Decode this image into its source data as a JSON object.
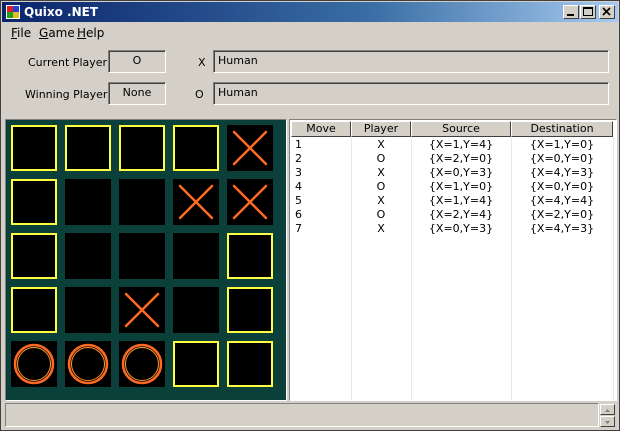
{
  "window": {
    "title": "Quixo .NET"
  },
  "menu": [
    {
      "label_u": "F",
      "label_rest": "ile"
    },
    {
      "label_u": "G",
      "label_rest": "ame"
    },
    {
      "label_u": "H",
      "label_rest": "elp"
    }
  ],
  "info": {
    "current_player_label": "Current Player",
    "current_player_value": "O",
    "winning_player_label": "Winning Player",
    "winning_player_value": "None",
    "x_label": "X",
    "x_player": "Human",
    "o_label": "O",
    "o_player": "Human"
  },
  "board": [
    [
      "empty-lit",
      "empty-lit",
      "empty-lit",
      "empty-lit",
      "x"
    ],
    [
      "empty-lit",
      "empty",
      "empty",
      "x",
      "x"
    ],
    [
      "empty-lit",
      "empty",
      "empty",
      "empty",
      "empty-lit"
    ],
    [
      "empty-lit",
      "empty",
      "x",
      "empty",
      "empty-lit"
    ],
    [
      "o",
      "o",
      "o",
      "empty-lit",
      "empty-lit"
    ]
  ],
  "colors": {
    "board_bg": "#0a3f3a",
    "cell_border": "#ffff40",
    "mark": "#ff6a20"
  },
  "moves": {
    "headers": [
      "Move",
      "Player",
      "Source",
      "Destination"
    ],
    "rows": [
      [
        "1",
        "X",
        "{X=1,Y=4}",
        "{X=1,Y=0}"
      ],
      [
        "2",
        "O",
        "{X=2,Y=0}",
        "{X=0,Y=0}"
      ],
      [
        "3",
        "X",
        "{X=0,Y=3}",
        "{X=4,Y=3}"
      ],
      [
        "4",
        "O",
        "{X=1,Y=0}",
        "{X=0,Y=0}"
      ],
      [
        "5",
        "X",
        "{X=1,Y=4}",
        "{X=4,Y=4}"
      ],
      [
        "6",
        "O",
        "{X=2,Y=4}",
        "{X=2,Y=0}"
      ],
      [
        "7",
        "X",
        "{X=0,Y=3}",
        "{X=4,Y=3}"
      ]
    ]
  }
}
